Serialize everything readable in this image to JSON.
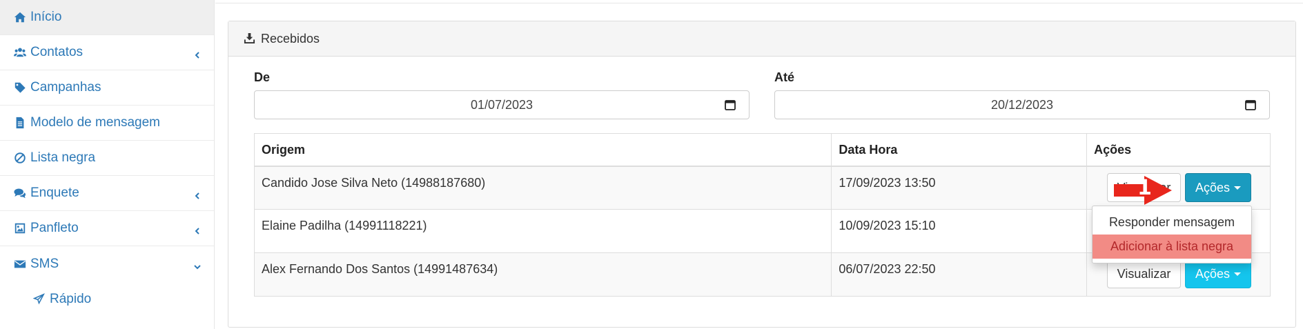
{
  "sidebar": {
    "items": [
      {
        "label": "Início",
        "icon": "home-icon",
        "active": true,
        "has_chevron": false
      },
      {
        "label": "Contatos",
        "icon": "users-icon",
        "has_chevron": true,
        "chevron": "left"
      },
      {
        "label": "Campanhas",
        "icon": "tag-icon",
        "has_chevron": false
      },
      {
        "label": "Modelo de mensagem",
        "icon": "file-text-icon",
        "has_chevron": false
      },
      {
        "label": "Lista negra",
        "icon": "ban-icon",
        "has_chevron": false
      },
      {
        "label": "Enquete",
        "icon": "comments-icon",
        "has_chevron": true,
        "chevron": "left"
      },
      {
        "label": "Panfleto",
        "icon": "image-icon",
        "has_chevron": true,
        "chevron": "left"
      },
      {
        "label": "SMS",
        "icon": "envelope-icon",
        "has_chevron": true,
        "chevron": "down"
      }
    ],
    "sub_items": [
      {
        "label": "Rápido",
        "icon": "paper-plane-icon"
      }
    ]
  },
  "panel": {
    "title": "Recebidos",
    "title_icon": "download-icon"
  },
  "filters": {
    "from_label": "De",
    "from_value": "01/07/2023",
    "to_label": "Até",
    "to_value": "20/12/2023"
  },
  "table": {
    "columns": [
      "Origem",
      "Data Hora",
      "Ações"
    ],
    "rows": [
      {
        "origem": "Candido Jose Silva Neto (14988187680)",
        "data_hora": "17/09/2023 13:50"
      },
      {
        "origem": "Elaine Padilha (14991118221)",
        "data_hora": "10/09/2023 15:10"
      },
      {
        "origem": "Alex Fernando Dos Santos (14991487634)",
        "data_hora": "06/07/2023 22:50"
      }
    ],
    "view_label": "Visualizar",
    "actions_label": "Ações"
  },
  "dropdown": {
    "items": [
      "Responder mensagem",
      "Adicionar à lista negra"
    ],
    "highlighted_index": 1
  },
  "annotation": {
    "number": "1"
  },
  "colors": {
    "link": "#2d79b7",
    "info_button": "#14c5ed",
    "info_button_pressed": "#1a9bbf",
    "highlight": "#f28b85",
    "annotation_arrow": "#e8261c"
  }
}
